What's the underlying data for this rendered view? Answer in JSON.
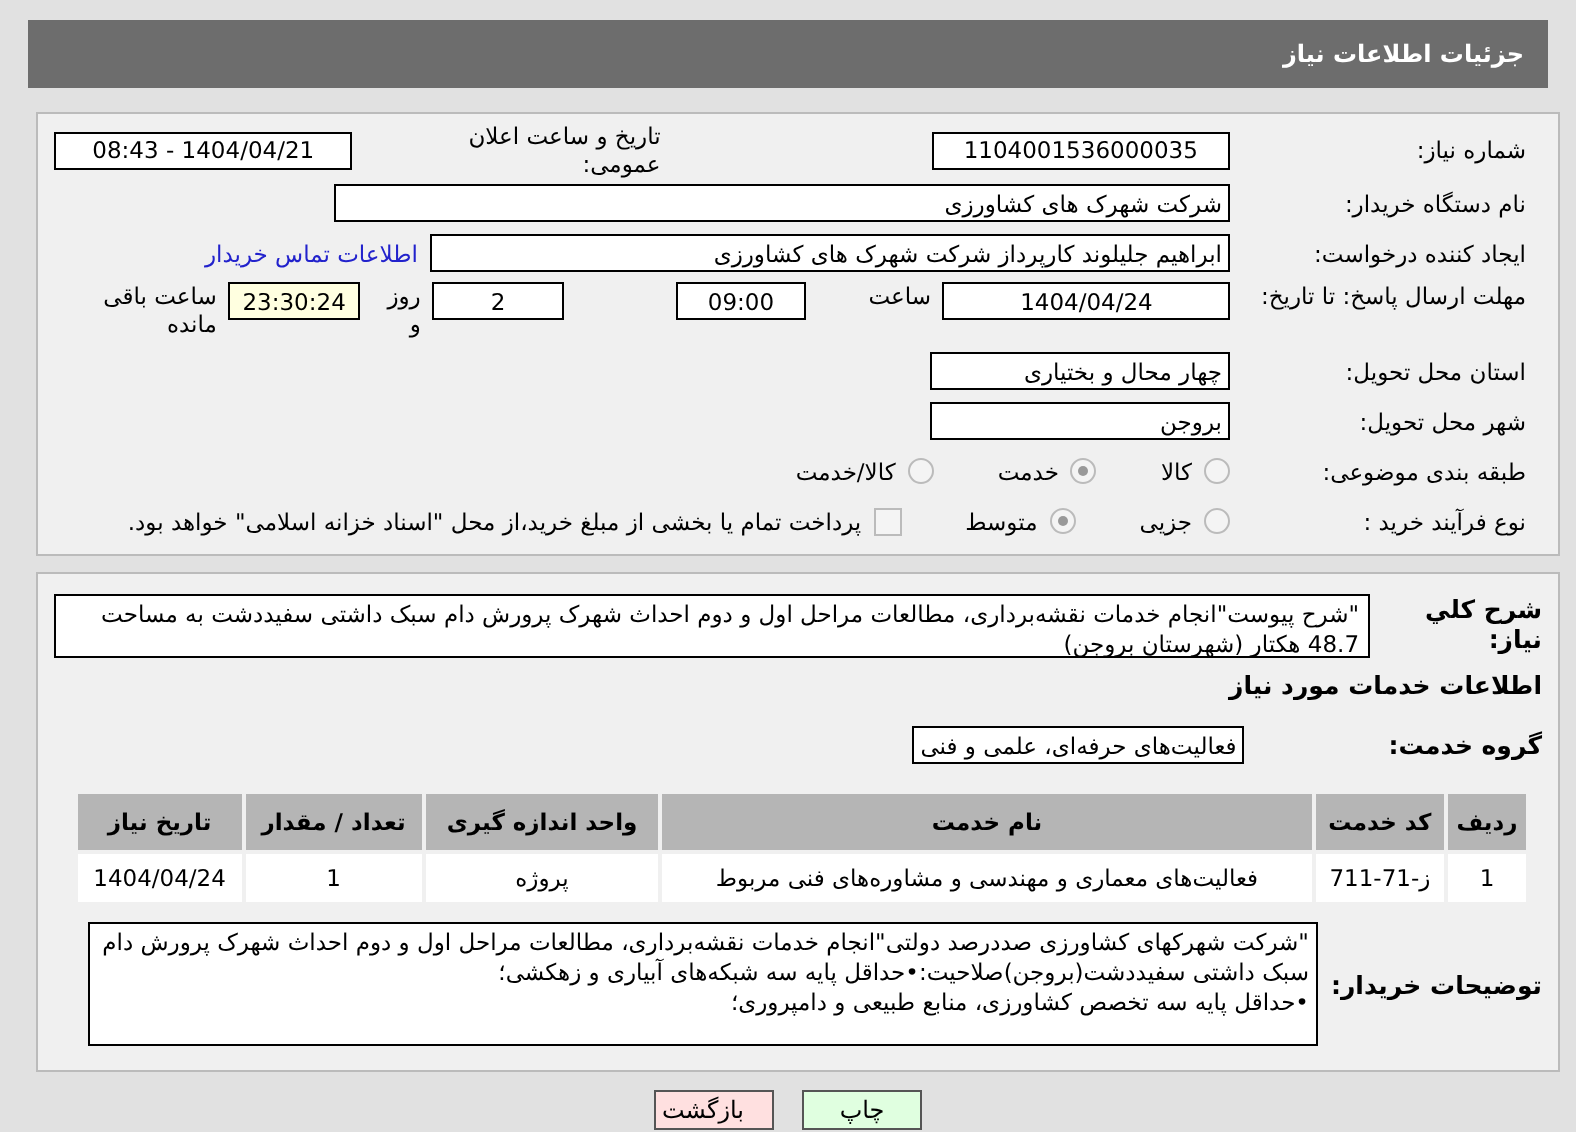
{
  "header": {
    "title": "جزئیات اطلاعات نیاز"
  },
  "need_number": {
    "label": "شماره نیاز:",
    "value": "1104001536000035"
  },
  "announce": {
    "label": "تاریخ و ساعت اعلان عمومی:",
    "value": "1404/04/21 - 08:43"
  },
  "buyer": {
    "label": "نام دستگاه خریدار:",
    "value": "شرکت شهرک های کشاورزی"
  },
  "creator": {
    "label": "ایجاد کننده درخواست:",
    "value": "ابراهیم جلیلوند کارپرداز شرکت شهرک های کشاورزی",
    "link": "اطلاعات تماس خریدار"
  },
  "deadline": {
    "label": "مهلت ارسال پاسخ: تا تاریخ:",
    "date": "1404/04/24",
    "time_label": "ساعت",
    "time": "09:00",
    "days": "2",
    "days_label": "روز و",
    "remaining": "23:30:24",
    "remaining_label": "ساعت باقی مانده"
  },
  "province": {
    "label": "استان محل تحویل:",
    "value": "چهار محال و بختیاری"
  },
  "city": {
    "label": "شهر محل تحویل:",
    "value": "بروجن"
  },
  "category": {
    "label": "طبقه بندی موضوعی:",
    "options": [
      {
        "label": "کالا",
        "selected": false
      },
      {
        "label": "خدمت",
        "selected": true
      },
      {
        "label": "کالا/خدمت",
        "selected": false
      }
    ]
  },
  "process": {
    "label": "نوع فرآیند خرید :",
    "options": [
      {
        "label": "جزیی",
        "selected": false
      },
      {
        "label": "متوسط",
        "selected": true
      }
    ],
    "treasury": {
      "checked": false,
      "label": "پرداخت تمام یا بخشی از مبلغ خرید،از محل \"اسناد خزانه اسلامی\" خواهد بود."
    }
  },
  "summary": {
    "label": "شرح کلي نياز:",
    "value": "\"شرح پیوست\"انجام خدمات نقشه‌برداری، مطالعات مراحل اول و دوم احداث شهرک پرورش دام سبک داشتی سفیددشت به مساحت 48.7 هکتار (شهرستان بروجن)"
  },
  "services_heading": "اطلاعات خدمات مورد نياز",
  "service_group": {
    "label": "گروه خدمت:",
    "value": "فعالیت‌های حرفه‌ای، علمی و فنی"
  },
  "table": {
    "columns": [
      "ردیف",
      "کد خدمت",
      "نام خدمت",
      "واحد اندازه گیری",
      "تعداد / مقدار",
      "تاریخ نیاز"
    ],
    "rows": [
      [
        "1",
        "ز-71-711",
        "فعالیت‌های معماری و مهندسی و مشاوره‌های فنی مربوط",
        "پروژه",
        "1",
        "1404/04/24"
      ]
    ]
  },
  "notes": {
    "label": "توضیحات خریدار:",
    "value": "\"شرکت شهرکهای کشاورزی صددرصد دولتی\"انجام خدمات نقشه‌برداری، مطالعات مراحل اول و دوم احداث شهرک پرورش دام سبک داشتی سفیددشت(بروجن)صلاحیت:•حداقل پایه سه شبکه‌های آبیاری و زهکشی؛\n•حداقل پایه سه تخصص کشاورزی، منابع طبیعی و دامپروری؛"
  },
  "buttons": [
    {
      "label": "چاپ",
      "kind": "print"
    },
    {
      "label": "بازگشت",
      "kind": "back"
    }
  ]
}
